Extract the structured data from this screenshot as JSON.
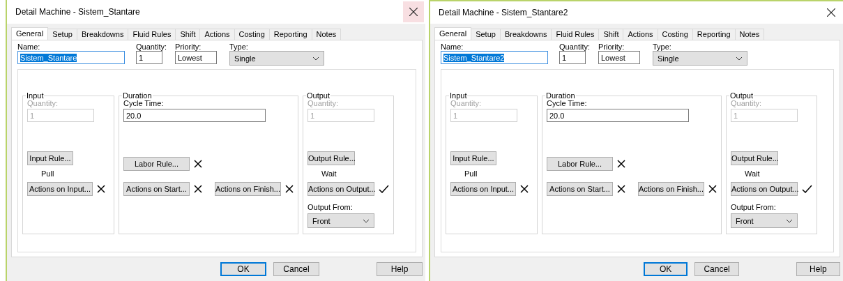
{
  "windows": [
    {
      "title": "Detail Machine - Sistem_Stantare",
      "close_hovered": true,
      "tabs": [
        {
          "label": "General",
          "selected": true
        },
        {
          "label": "Setup",
          "selected": false
        },
        {
          "label": "Breakdowns",
          "selected": false
        },
        {
          "label": "Fluid Rules",
          "selected": false
        },
        {
          "label": "Shift",
          "selected": false
        },
        {
          "label": "Actions",
          "selected": false
        },
        {
          "label": "Costing",
          "selected": false
        },
        {
          "label": "Reporting",
          "selected": false
        },
        {
          "label": "Notes",
          "selected": false
        }
      ],
      "name": {
        "label": "Name:",
        "value": "Sistem_Stantare",
        "text_selected": true
      },
      "quantity": {
        "label": "Quantity:",
        "value": "1"
      },
      "priority": {
        "label": "Priority:",
        "value": "Lowest"
      },
      "type": {
        "label": "Type:",
        "value": "Single"
      },
      "input": {
        "title": "Input",
        "quantity_label": "Quantity:",
        "quantity_value": "1",
        "disabled": true,
        "rule_button": "Input Rule...",
        "rule_value": "Pull",
        "action": {
          "label": "Actions on Input...",
          "defined": false
        }
      },
      "duration": {
        "title": "Duration",
        "cycle_label": "Cycle Time:",
        "cycle_value": "20.0",
        "labor": {
          "label": "Labor Rule...",
          "defined": false
        },
        "actions": [
          {
            "label": "Actions on Start...",
            "defined": false
          },
          {
            "label": "Actions on Finish...",
            "defined": false
          }
        ]
      },
      "output": {
        "title": "Output",
        "quantity_label": "Quantity:",
        "quantity_value": "1",
        "disabled": true,
        "rule_button": "Output Rule...",
        "rule_value": "Wait",
        "action": {
          "label": "Actions on Output...",
          "defined": true
        },
        "from_label": "Output From:",
        "from_value": "Front"
      },
      "buttons": [
        {
          "label": "OK",
          "default": true
        },
        {
          "label": "Cancel",
          "default": false
        },
        {
          "label": "Help",
          "default": false
        }
      ]
    },
    {
      "title": "Detail Machine - Sistem_Stantare2",
      "close_hovered": false,
      "tabs": [
        {
          "label": "General",
          "selected": true
        },
        {
          "label": "Setup",
          "selected": false
        },
        {
          "label": "Breakdowns",
          "selected": false
        },
        {
          "label": "Fluid Rules",
          "selected": false
        },
        {
          "label": "Shift",
          "selected": false
        },
        {
          "label": "Actions",
          "selected": false
        },
        {
          "label": "Costing",
          "selected": false
        },
        {
          "label": "Reporting",
          "selected": false
        },
        {
          "label": "Notes",
          "selected": false
        }
      ],
      "name": {
        "label": "Name:",
        "value": "Sistem_Stantare2",
        "text_selected": true
      },
      "quantity": {
        "label": "Quantity:",
        "value": "1"
      },
      "priority": {
        "label": "Priority:",
        "value": "Lowest"
      },
      "type": {
        "label": "Type:",
        "value": "Single"
      },
      "input": {
        "title": "Input",
        "quantity_label": "Quantity:",
        "quantity_value": "1",
        "disabled": true,
        "rule_button": "Input Rule...",
        "rule_value": "Pull",
        "action": {
          "label": "Actions on Input...",
          "defined": false
        }
      },
      "duration": {
        "title": "Duration",
        "cycle_label": "Cycle Time:",
        "cycle_value": "20.0",
        "labor": {
          "label": "Labor Rule...",
          "defined": false
        },
        "actions": [
          {
            "label": "Actions on Start...",
            "defined": false
          },
          {
            "label": "Actions on Finish...",
            "defined": false
          }
        ]
      },
      "output": {
        "title": "Output",
        "quantity_label": "Quantity:",
        "quantity_value": "1",
        "disabled": true,
        "rule_button": "Output Rule...",
        "rule_value": "Wait",
        "action": {
          "label": "Actions on Output...",
          "defined": true
        },
        "from_label": "Output From:",
        "from_value": "Front"
      },
      "buttons": [
        {
          "label": "OK",
          "default": true
        },
        {
          "label": "Cancel",
          "default": false
        },
        {
          "label": "Help",
          "default": false
        }
      ]
    }
  ]
}
